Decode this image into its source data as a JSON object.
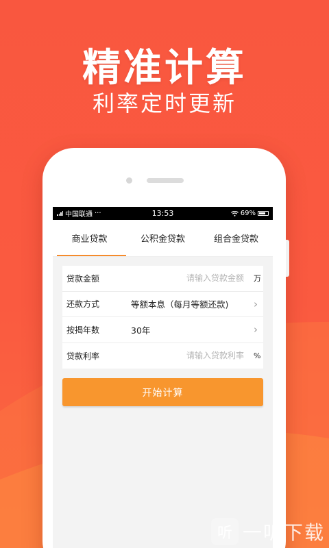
{
  "hero": {
    "title": "精准计算",
    "subtitle": "利率定时更新"
  },
  "statusbar": {
    "carrier": "中国联通",
    "more": "···",
    "time": "13:53",
    "battery": "69%"
  },
  "tabs": [
    {
      "label": "商业贷款",
      "active": true
    },
    {
      "label": "公积金贷款",
      "active": false
    },
    {
      "label": "组合金贷款",
      "active": false
    }
  ],
  "form": {
    "amount": {
      "label": "贷款金额",
      "placeholder": "请输入贷款金额",
      "unit": "万"
    },
    "method": {
      "label": "还款方式",
      "value": "等额本息（每月等额还款)",
      "icon": "chevron-right-icon"
    },
    "years": {
      "label": "按揭年数",
      "value": "30年",
      "icon": "chevron-right-icon"
    },
    "rate": {
      "label": "贷款利率",
      "placeholder": "请输入贷款利率",
      "unit": "%"
    }
  },
  "actions": {
    "calculate_label": "开始计算"
  },
  "watermark": {
    "logo": "听",
    "text": "一听下载"
  },
  "colors": {
    "background": "#fa5a40",
    "accent": "#f8962e",
    "tab_underline": "#f58b2c"
  }
}
